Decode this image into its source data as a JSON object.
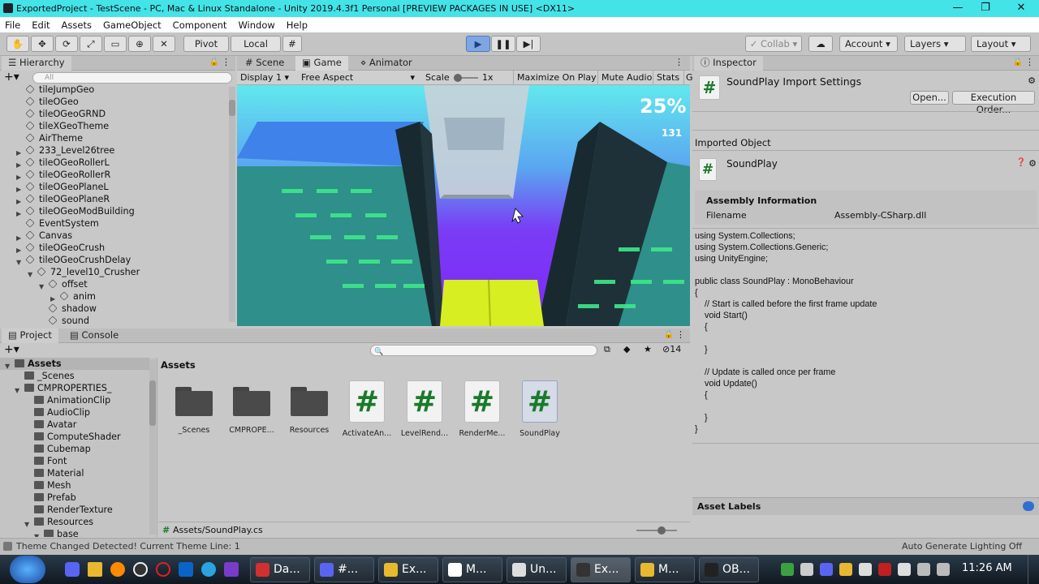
{
  "window": {
    "title": "ExportedProject - TestScene - PC, Mac & Linux Standalone - Unity 2019.4.3f1 Personal [PREVIEW PACKAGES IN USE] <DX11>"
  },
  "menu": [
    "File",
    "Edit",
    "Assets",
    "GameObject",
    "Component",
    "Window",
    "Help"
  ],
  "toolbar": {
    "pivot": "Pivot",
    "local": "Local",
    "collab": "Collab",
    "account": "Account",
    "layers": "Layers",
    "layout": "Layout"
  },
  "hierarchy": {
    "tab": "Hierarchy",
    "search_placeholder": "All",
    "items": [
      {
        "label": "tileJumpGeo",
        "indent": 1,
        "arrow": false
      },
      {
        "label": "tileOGeo",
        "indent": 1,
        "arrow": false
      },
      {
        "label": "tileOGeoGRND",
        "indent": 1,
        "arrow": false
      },
      {
        "label": "tileXGeoTheme",
        "indent": 1,
        "arrow": false
      },
      {
        "label": "AirTheme",
        "indent": 1,
        "arrow": false
      },
      {
        "label": "233_Level26tree",
        "indent": 1,
        "arrow": "right"
      },
      {
        "label": "tileOGeoRollerL",
        "indent": 1,
        "arrow": "right"
      },
      {
        "label": "tileOGeoRollerR",
        "indent": 1,
        "arrow": "right"
      },
      {
        "label": "tileOGeoPlaneL",
        "indent": 1,
        "arrow": "right"
      },
      {
        "label": "tileOGeoPlaneR",
        "indent": 1,
        "arrow": "right"
      },
      {
        "label": "tileOGeoModBuilding",
        "indent": 1,
        "arrow": "right"
      },
      {
        "label": "EventSystem",
        "indent": 1,
        "arrow": false
      },
      {
        "label": "Canvas",
        "indent": 1,
        "arrow": "right"
      },
      {
        "label": "tileOGeoCrush",
        "indent": 1,
        "arrow": "right"
      },
      {
        "label": "tileOGeoCrushDelay",
        "indent": 1,
        "arrow": "down"
      },
      {
        "label": "72_level10_Crusher",
        "indent": 2,
        "arrow": "down"
      },
      {
        "label": "offset",
        "indent": 3,
        "arrow": "down"
      },
      {
        "label": "anim",
        "indent": 4,
        "arrow": "right"
      },
      {
        "label": "shadow",
        "indent": 3,
        "arrow": false
      },
      {
        "label": "sound",
        "indent": 3,
        "arrow": false
      }
    ]
  },
  "game_tabs": {
    "scene": "Scene",
    "game": "Game",
    "animator": "Animator"
  },
  "game_bar": {
    "display": "Display 1",
    "aspect": "Free Aspect",
    "scale_label": "Scale",
    "scale_value": "1x",
    "maximize": "Maximize On Play",
    "mute": "Mute Audio",
    "stats": "Stats",
    "gizmos": "G"
  },
  "game_view": {
    "percent": "25%",
    "score": "131"
  },
  "inspector": {
    "tab": "Inspector",
    "title": "SoundPlay Import Settings",
    "open": "Open...",
    "exec": "Execution Order...",
    "imported_object": "Imported Object",
    "object_name": "SoundPlay",
    "assembly_header": "Assembly Information",
    "filename_label": "Filename",
    "filename_value": "Assembly-CSharp.dll",
    "asset_labels": "Asset Labels",
    "code": "using System.Collections;\nusing System.Collections.Generic;\nusing UnityEngine;\n\npublic class SoundPlay : MonoBehaviour\n{\n    // Start is called before the first frame update\n    void Start()\n    {\n\n    }\n\n    // Update is called once per frame\n    void Update()\n    {\n\n    }\n}"
  },
  "project": {
    "tab_project": "Project",
    "tab_console": "Console",
    "hidden_count": "14",
    "assets_label": "Assets",
    "path": "Assets/SoundPlay.cs",
    "tree": [
      {
        "label": "Assets",
        "indent": 0,
        "arrow": "down",
        "bold": true
      },
      {
        "label": "_Scenes",
        "indent": 1,
        "arrow": false
      },
      {
        "label": "CMPROPERTIES_",
        "indent": 1,
        "arrow": "down"
      },
      {
        "label": "AnimationClip",
        "indent": 2,
        "arrow": false
      },
      {
        "label": "AudioClip",
        "indent": 2,
        "arrow": false
      },
      {
        "label": "Avatar",
        "indent": 2,
        "arrow": false
      },
      {
        "label": "ComputeShader",
        "indent": 2,
        "arrow": false
      },
      {
        "label": "Cubemap",
        "indent": 2,
        "arrow": false
      },
      {
        "label": "Font",
        "indent": 2,
        "arrow": false
      },
      {
        "label": "Material",
        "indent": 2,
        "arrow": false
      },
      {
        "label": "Mesh",
        "indent": 2,
        "arrow": false
      },
      {
        "label": "Prefab",
        "indent": 2,
        "arrow": false
      },
      {
        "label": "RenderTexture",
        "indent": 2,
        "arrow": false
      },
      {
        "label": "Resources",
        "indent": 2,
        "arrow": "down"
      },
      {
        "label": "base",
        "indent": 3,
        "arrow": "down"
      }
    ],
    "assets": [
      {
        "label": "_Scenes",
        "kind": "folder"
      },
      {
        "label": "CMPROPE...",
        "kind": "folder"
      },
      {
        "label": "Resources",
        "kind": "folder"
      },
      {
        "label": "ActivateAn...",
        "kind": "script"
      },
      {
        "label": "LevelRend...",
        "kind": "script"
      },
      {
        "label": "RenderMe...",
        "kind": "script"
      },
      {
        "label": "SoundPlay",
        "kind": "script",
        "selected": true
      }
    ]
  },
  "status": {
    "left": "Theme Changed Detected! Current Theme Line: 1",
    "right": "Auto Generate Lighting Off"
  },
  "taskbar": {
    "time": "11:26 AM",
    "items": [
      {
        "label": "Da...",
        "color": "#d03030"
      },
      {
        "label": "#...",
        "color": "#5865f2"
      },
      {
        "label": "Ex...",
        "color": "#e8b830"
      },
      {
        "label": "M...",
        "color": "#ffffff"
      },
      {
        "label": "Un...",
        "color": "#dddddd"
      },
      {
        "label": "Ex...",
        "color": "#333333"
      },
      {
        "label": "M...",
        "color": "#e8b830"
      },
      {
        "label": "OB...",
        "color": "#222222"
      }
    ]
  }
}
